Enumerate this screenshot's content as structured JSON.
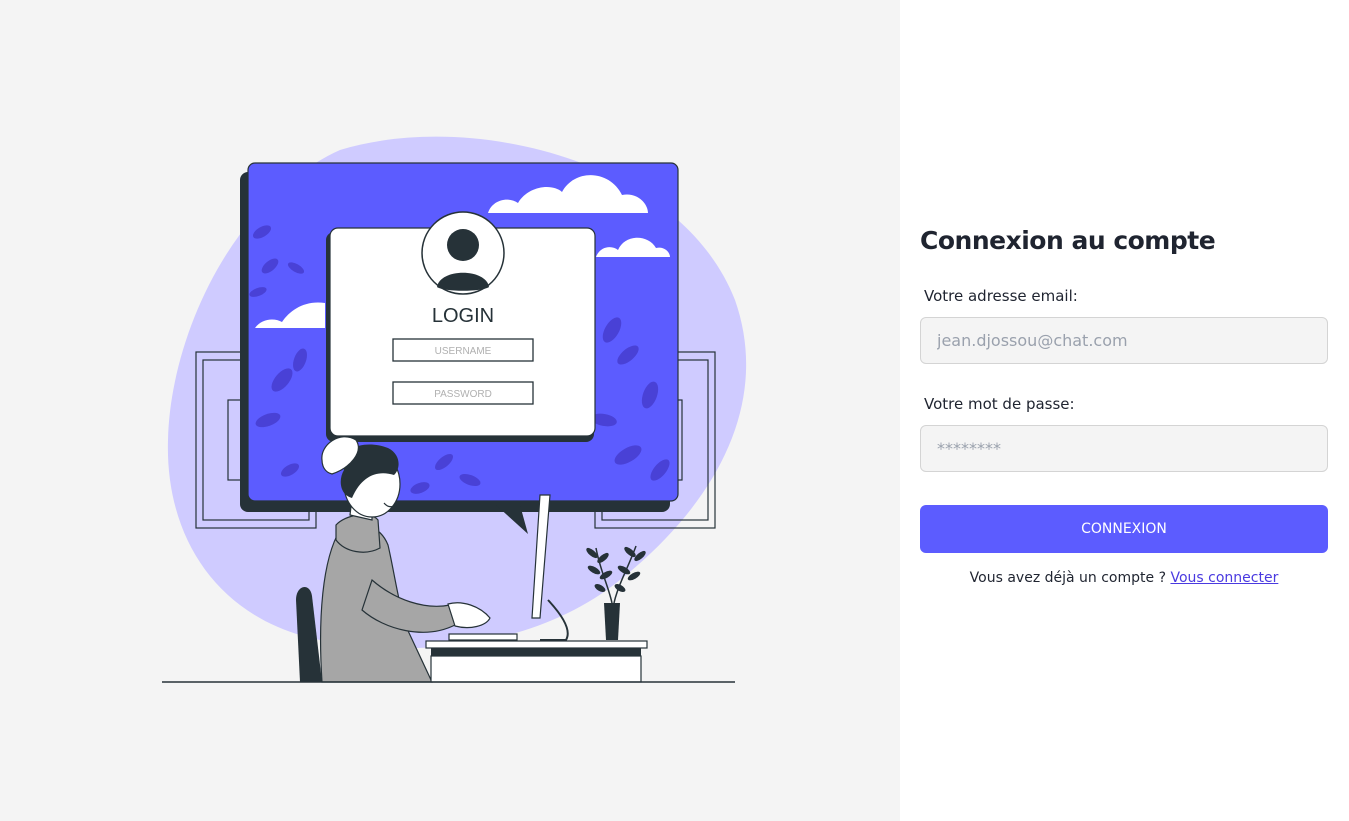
{
  "illustration": {
    "screen_title": "LOGIN",
    "username_placeholder": "USERNAME",
    "password_placeholder": "PASSWORD"
  },
  "form": {
    "title": "Connexion au compte",
    "email_label": "Votre adresse email:",
    "email_placeholder": "jean.djossou@chat.com",
    "email_value": "",
    "password_label": "Votre mot de passe:",
    "password_placeholder": "********",
    "password_value": "",
    "submit_label": "CONNEXION",
    "signup_prompt": "Vous avez déjà un compte ?",
    "signup_link": "Vous connecter"
  },
  "colors": {
    "accent": "#5c5cff",
    "blob": "#cfcbff",
    "left_background": "#f4f4f4",
    "dark": "#263238"
  }
}
